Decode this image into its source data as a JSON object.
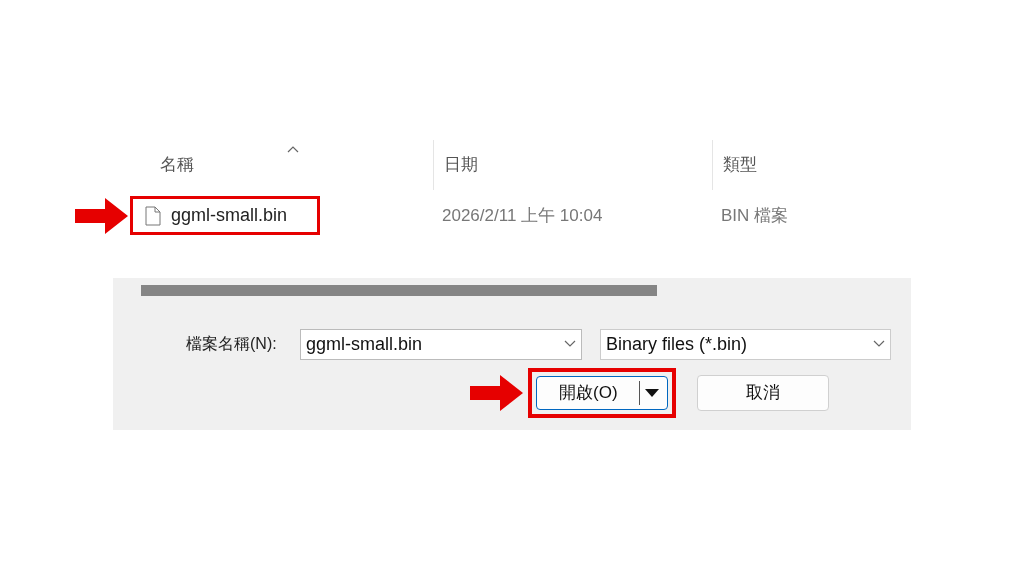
{
  "file_list": {
    "columns": [
      {
        "label": "名稱",
        "sorted": true
      },
      {
        "label": "日期",
        "sorted": false
      },
      {
        "label": "類型",
        "sorted": false
      }
    ],
    "rows": [
      {
        "name": "ggml-small.bin",
        "date": "2026/2/11 上午 10:04",
        "type": "BIN 檔案",
        "callout": true
      }
    ]
  },
  "footer": {
    "filename_label": "檔案名稱(N):",
    "filename_value": "ggml-small.bin",
    "filter_value": "Binary files (*.bin)",
    "buttons": [
      {
        "kind": "split",
        "label": "開啟(O)",
        "callout": true
      },
      {
        "kind": "plain",
        "label": "取消",
        "callout": false
      }
    ]
  }
}
